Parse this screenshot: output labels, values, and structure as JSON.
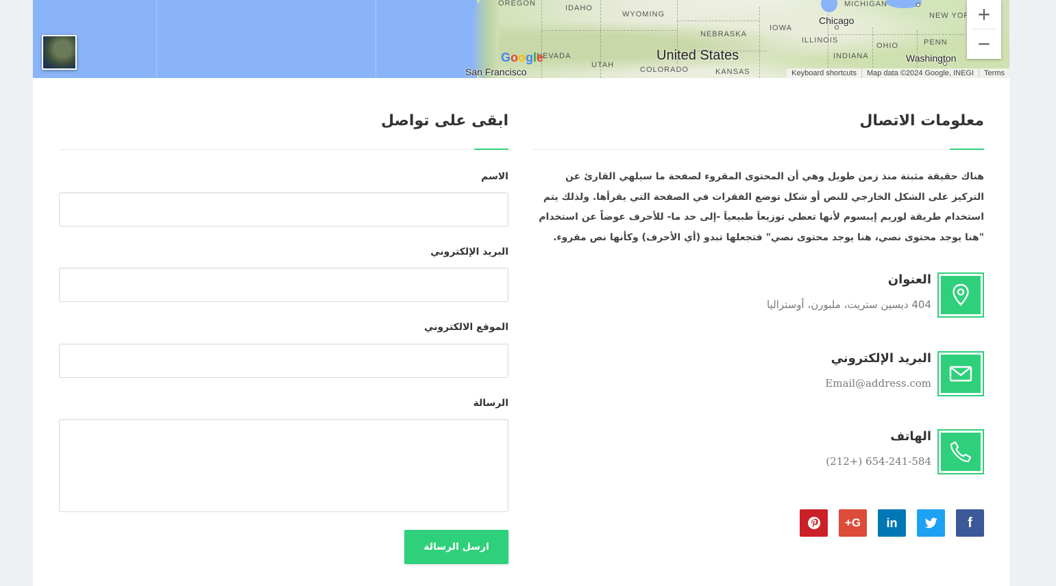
{
  "map": {
    "labels": {
      "oregon": "OREGON",
      "idaho": "IDAHO",
      "wyoming": "WYOMING",
      "nebraska": "NEBRASKA",
      "iowa": "IOWA",
      "illinois": "ILLINOIS",
      "indiana": "INDIANA",
      "ohio": "OHIO",
      "penn": "PENN",
      "michigan": "MICHIGAN",
      "nevada": "NEVADA",
      "utah": "UTAH",
      "colorado": "COLORADO",
      "kansas": "KANSAS",
      "newyork": "NEW YOR"
    },
    "cities": {
      "chicago": "Chicago",
      "washington": "Washington",
      "san_francisco": "San Francisco"
    },
    "country": "United States",
    "google_logo": [
      "G",
      "o",
      "o",
      "g",
      "l",
      "e"
    ],
    "google_colors": [
      "#4285f4",
      "#ea4335",
      "#fbbc05",
      "#4285f4",
      "#34a853",
      "#ea4335"
    ],
    "zoom_in": "+",
    "zoom_out": "−",
    "attribution": {
      "shortcuts": "Keyboard shortcuts",
      "mapdata": "Map data ©2024 Google, INEGI",
      "terms": "Terms"
    }
  },
  "info": {
    "title": "معلومات الاتصال",
    "description": "هناك حقيقة مثبتة منذ زمن طويل وهي أن المحتوى المقروء لصفحة ما سيلهي القارئ عن التركيز على الشكل الخارجي للنص أو شكل توضع الفقرات في الصفحة التي يقرأها. ولذلك يتم استخدام طريقة لوريم إيبسوم لأنها تعطي توزيعاَ طبيعياَ -إلى حد ما- للأحرف عوضاً عن استخدام \"هنا يوجد محتوى نصي، هنا يوجد محتوى نصي\" فتجعلها تبدو (أي الأحرف) وكأنها نص مقروء.",
    "address": {
      "title": "العنوان",
      "value": "404 ديسين ستريت، ملبورن، أوستراليا",
      "icon": "map-pin-icon"
    },
    "email": {
      "title": "البريد الإلكتروني",
      "value": "Email@address.com",
      "icon": "envelope-icon"
    },
    "phone": {
      "title": "الهاتف",
      "value": "(212+) 654-241-584",
      "icon": "phone-icon"
    },
    "accent_color": "#2fd07b"
  },
  "socials": {
    "facebook": {
      "glyph": "f",
      "color": "#3b5998"
    },
    "twitter": {
      "glyph": "t",
      "color": "#1da1f2"
    },
    "linkedin": {
      "glyph": "in",
      "color": "#0077b5"
    },
    "googleplus": {
      "glyph": "G+",
      "color": "#dd4b39"
    },
    "pinterest": {
      "glyph": "p",
      "color": "#cb2027"
    }
  },
  "form": {
    "title": "ابقى على تواصل",
    "name_label": "الاسم",
    "name_value": "",
    "email_label": "البريد الإلكتروني",
    "email_value": "",
    "website_label": "الموقع الالكتروني",
    "website_value": "",
    "message_label": "الرسالة",
    "message_value": "",
    "submit_label": "ارسل الرسالة"
  }
}
